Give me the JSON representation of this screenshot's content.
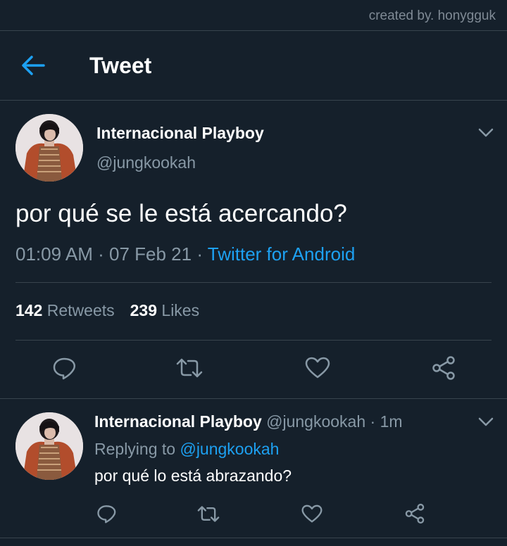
{
  "watermark": "created by. honygguk",
  "header": {
    "title": "Tweet",
    "back_icon": "arrow-left-icon"
  },
  "tweet": {
    "display_name": "Internacional Playboy",
    "handle": "@jungkookah",
    "text": "por qué se le está acercando?",
    "time": "01:09 AM",
    "date": "07 Feb 21",
    "separator": "·",
    "source": "Twitter for Android",
    "retweets_count": "142",
    "retweets_label": "Retweets",
    "likes_count": "239",
    "likes_label": "Likes",
    "actions": [
      "reply-icon",
      "retweet-icon",
      "like-icon",
      "share-icon"
    ]
  },
  "reply": {
    "display_name": "Internacional Playboy",
    "handle": "@jungkookah",
    "time_ago": "· 1m",
    "replying_prefix": "Replying to",
    "replying_to": "@jungkookah",
    "text": "por qué lo está abrazando?"
  },
  "colors": {
    "background": "#15202b",
    "divider": "#38444d",
    "secondary_text": "#8899a6",
    "accent": "#1da1f2"
  }
}
